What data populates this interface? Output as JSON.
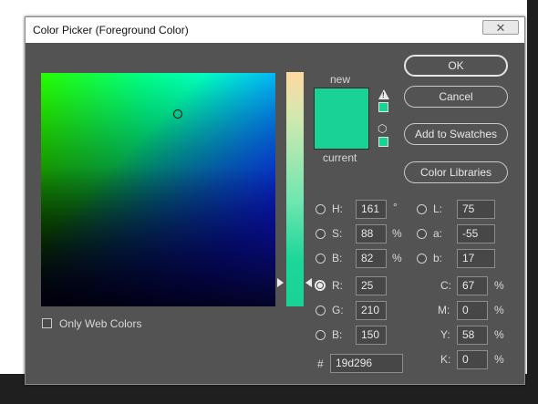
{
  "window": {
    "title": "Color Picker (Foreground Color)",
    "close_glyph": "✕"
  },
  "labels": {
    "new": "new",
    "current": "current"
  },
  "colors": {
    "current": "#19d296",
    "new": "#19d296",
    "dialog_bg": "#535353"
  },
  "buttons": {
    "ok": "OK",
    "cancel": "Cancel",
    "add_to_swatches": "Add to Swatches",
    "color_libraries": "Color Libraries"
  },
  "hsb": {
    "h": {
      "label": "H:",
      "value": "161",
      "unit": "°"
    },
    "s": {
      "label": "S:",
      "value": "88",
      "unit": "%"
    },
    "b": {
      "label": "B:",
      "value": "82",
      "unit": "%"
    }
  },
  "lab": {
    "l": {
      "label": "L:",
      "value": "75"
    },
    "a": {
      "label": "a:",
      "value": "-55"
    },
    "b": {
      "label": "b:",
      "value": "17"
    }
  },
  "rgb": {
    "r": {
      "label": "R:",
      "value": "25"
    },
    "g": {
      "label": "G:",
      "value": "210"
    },
    "b": {
      "label": "B:",
      "value": "150"
    }
  },
  "cmyk": {
    "c": {
      "label": "C:",
      "value": "67",
      "unit": "%"
    },
    "m": {
      "label": "M:",
      "value": "0",
      "unit": "%"
    },
    "y": {
      "label": "Y:",
      "value": "58",
      "unit": "%"
    },
    "k": {
      "label": "K:",
      "value": "0",
      "unit": "%"
    }
  },
  "hex": {
    "label": "#",
    "value": "19d296"
  },
  "only_web_colors": "Only Web Colors",
  "selected_channel": "R",
  "icons": {
    "gamut_warning": "warning-triangle-icon",
    "web_safe": "cube-icon"
  }
}
